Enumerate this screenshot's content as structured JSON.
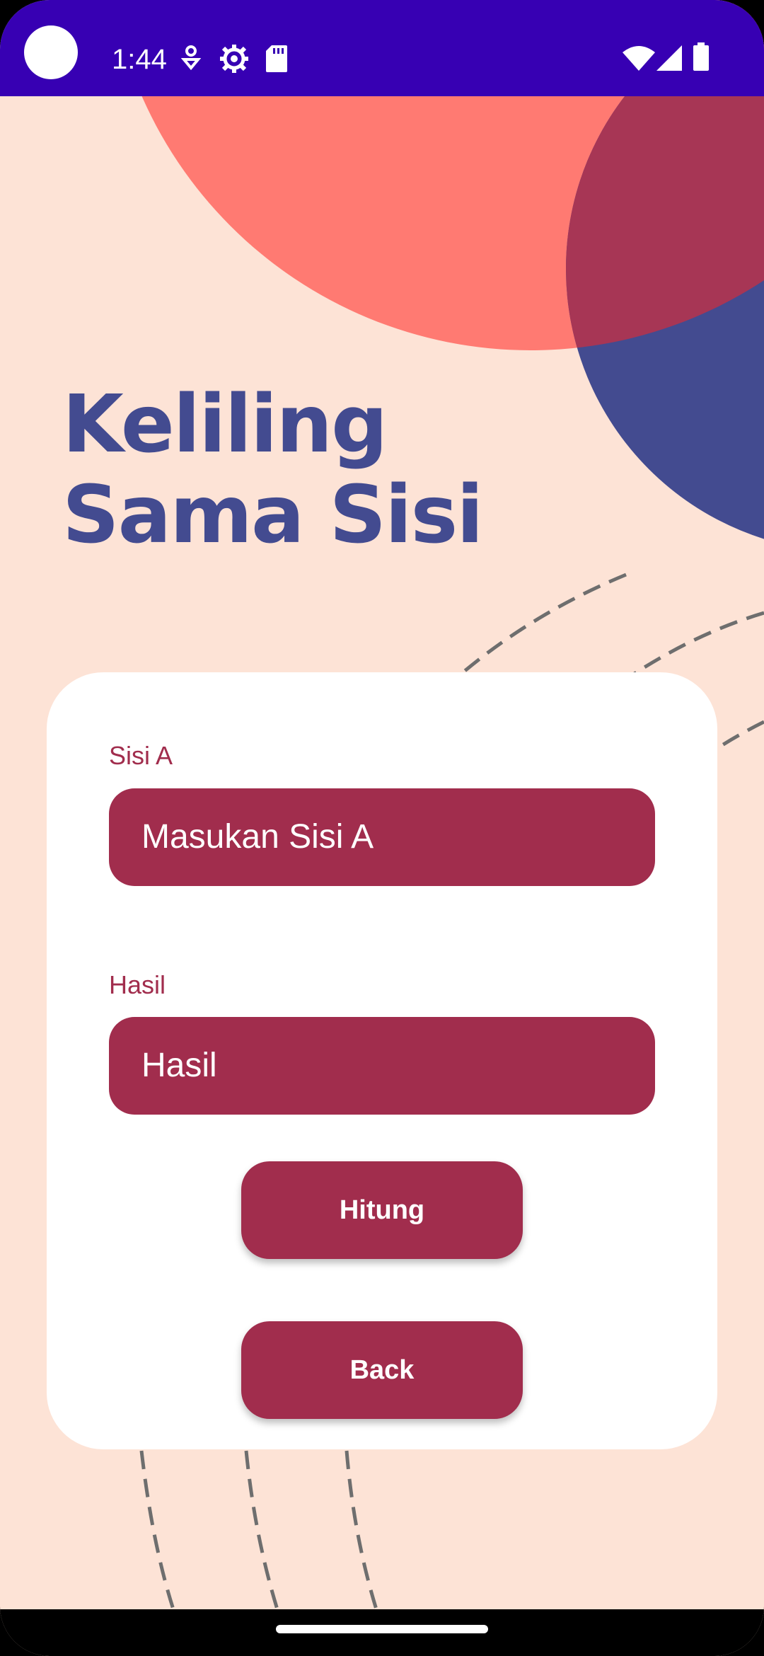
{
  "status_bar": {
    "time": "1:44",
    "left_icons": [
      "notification-icon",
      "settings-gear-icon",
      "sd-card-icon"
    ],
    "right_icons": [
      "wifi-icon",
      "cell-signal-icon",
      "battery-icon"
    ]
  },
  "page": {
    "title_line1": "Keliling",
    "title_line2": "Sama Sisi"
  },
  "form": {
    "side_a": {
      "label": "Sisi A",
      "placeholder": "Masukan Sisi A"
    },
    "result": {
      "label": "Hasil",
      "placeholder": "Hasil"
    },
    "calculate_label": "Hitung",
    "back_label": "Back"
  },
  "colors": {
    "background": "#fde3d6",
    "status_bar": "#3700b3",
    "accent": "#a12d4d",
    "title": "#434b90",
    "coral_circle": "#ff7a72",
    "navy_circle": "#434b90"
  }
}
